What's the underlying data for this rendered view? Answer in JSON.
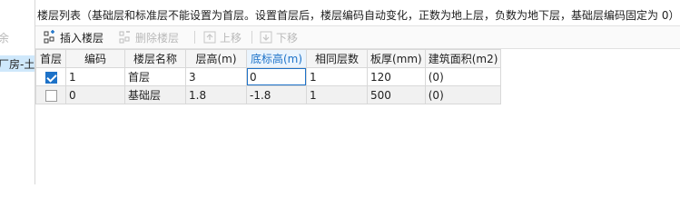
{
  "left_panel": {
    "top_text": "余",
    "selected_text": "厂房-土建"
  },
  "title": "楼层列表（基础层和标准层不能设置为首层。设置首层后，楼层编码自动变化，正数为地上层，负数为地下层，基础层编码固定为 0）",
  "toolbar": {
    "insert_label": "插入楼层",
    "delete_label": "删除楼层",
    "move_up_label": "上移",
    "move_down_label": "下移"
  },
  "table": {
    "headers": [
      "首层",
      "编码",
      "楼层名称",
      "层高(m)",
      "底标高(m)",
      "相同层数",
      "板厚(mm)",
      "建筑面积(m2)"
    ],
    "active_header_index": 4,
    "rows": [
      {
        "checked": true,
        "code": "1",
        "name": "首层",
        "height": "3",
        "bottom_elevation": "0",
        "same_floors": "1",
        "slab_thickness": "120",
        "area": "(0)"
      },
      {
        "checked": false,
        "code": "0",
        "name": "基础层",
        "height": "1.8",
        "bottom_elevation": "-1.8",
        "same_floors": "1",
        "slab_thickness": "500",
        "area": "(0)"
      }
    ]
  },
  "colors": {
    "accent": "#1d72c8",
    "selected_background": "#cfe8fb",
    "grid_line": "#d8d8d8"
  },
  "icons": {
    "insert": "insert-floor-icon",
    "delete": "delete-floor-icon",
    "up": "move-up-icon",
    "down": "move-down-icon"
  }
}
